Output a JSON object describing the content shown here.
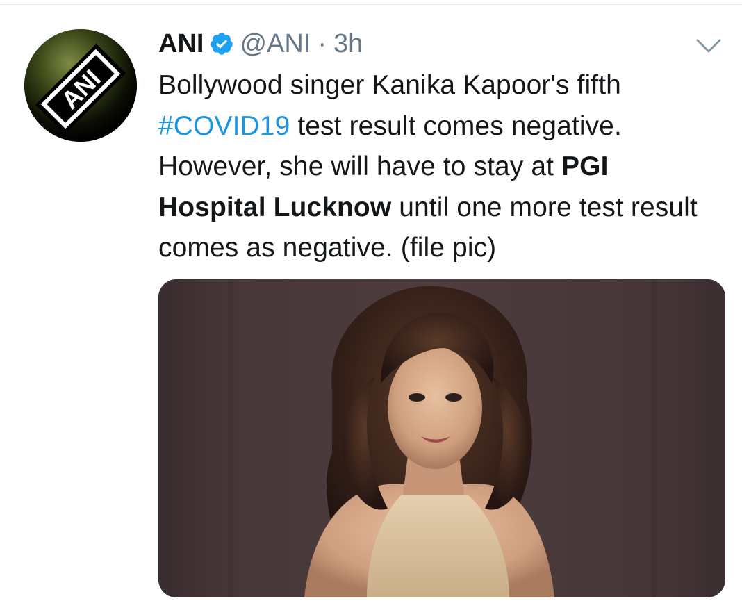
{
  "tweet": {
    "author_name": "ANI",
    "handle": "@ANI",
    "separator": "·",
    "time": "3h",
    "avatar_text": "ANI",
    "text": {
      "part1": "Bollywood singer Kanika Kapoor's fifth",
      "hashtag": "#COVID19",
      "part2": " test result comes negative. However, she will have to stay at ",
      "bold": "PGI Hospital Lucknow",
      "part3": " until one more test result comes as negative. (file pic)"
    },
    "icons": {
      "verified": "verified-badge-icon",
      "menu": "chevron-down-icon"
    },
    "colors": {
      "link": "#1b95e0",
      "verified": "#1da1f2",
      "secondary_text": "#657786",
      "primary_text": "#14171a"
    }
  }
}
